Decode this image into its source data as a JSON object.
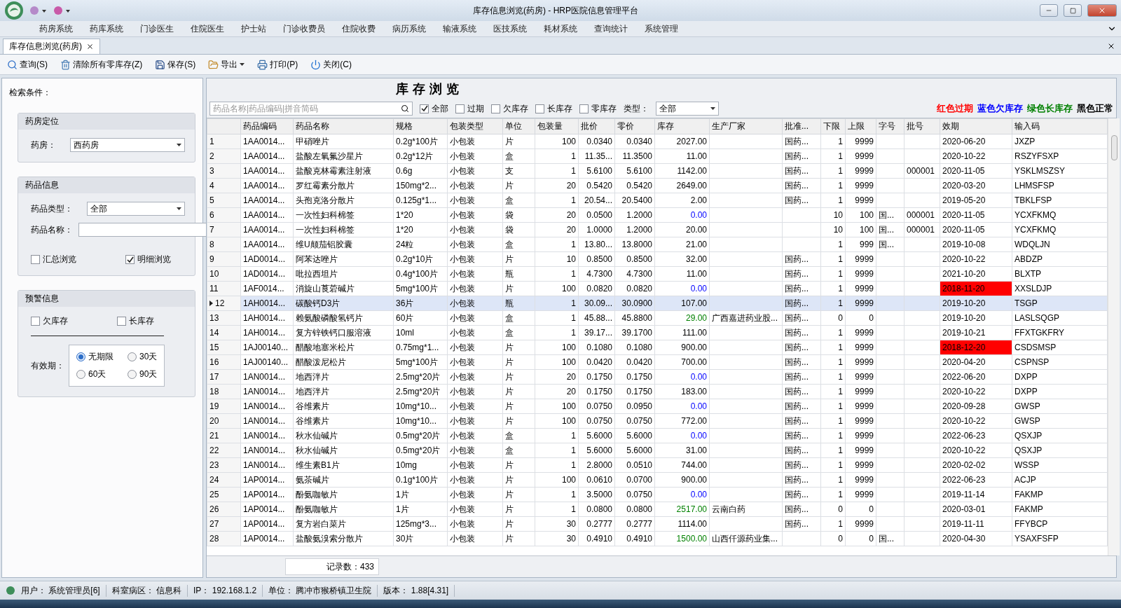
{
  "window": {
    "title": "库存信息浏览(药房) - HRP医院信息管理平台"
  },
  "menu": [
    "药房系统",
    "药库系统",
    "门诊医生",
    "住院医生",
    "护士站",
    "门诊收费员",
    "住院收费",
    "病历系统",
    "输液系统",
    "医技系统",
    "耗材系统",
    "查询统计",
    "系统管理"
  ],
  "doc_tabs": [
    {
      "label": "库存信息浏览(药房)",
      "selected": true
    }
  ],
  "toolbar": [
    {
      "kind": "search",
      "label": "查询(S)",
      "dropdown": false
    },
    {
      "kind": "clear",
      "label": "清除所有零库存(Z)",
      "dropdown": false
    },
    {
      "kind": "save",
      "label": "保存(S)",
      "dropdown": false
    },
    {
      "kind": "export",
      "label": "导出",
      "dropdown": true
    },
    {
      "kind": "print",
      "label": "打印(P)",
      "dropdown": false
    },
    {
      "kind": "close",
      "label": "关闭(C)",
      "dropdown": false
    }
  ],
  "criteria": {
    "label": "检索条件：",
    "pharmacy_group": {
      "title": "药房定位",
      "field_label": "药房：",
      "value": "西药房"
    },
    "drug_group": {
      "title": "药品信息",
      "type_label": "药品类型：",
      "type_value": "全部",
      "name_label": "药品名称：",
      "checkboxes": [
        {
          "label": "汇总浏览",
          "checked": false
        },
        {
          "label": "明细浏览",
          "checked": true
        }
      ]
    },
    "warning_group": {
      "title": "预警信息",
      "checkboxes": [
        {
          "label": "欠库存",
          "checked": false
        },
        {
          "label": "长库存",
          "checked": false
        }
      ],
      "expiry_label": "有效期：",
      "expiry_options": [
        {
          "label": "无期限",
          "selected": true
        },
        {
          "label": "30天",
          "selected": false
        },
        {
          "label": "60天",
          "selected": false
        },
        {
          "label": "90天",
          "selected": false
        }
      ]
    }
  },
  "browser": {
    "title": "库存浏览",
    "search": {
      "placeholder": "药品名称|药品编码|拼音简码"
    },
    "filters": [
      {
        "label": "全部",
        "checked": true
      },
      {
        "label": "过期",
        "checked": false
      },
      {
        "label": "欠库存",
        "checked": false
      },
      {
        "label": "长库存",
        "checked": false
      },
      {
        "label": "零库存",
        "checked": false
      }
    ],
    "type_label": "类型：",
    "type_value": "全部",
    "legend": [
      {
        "label": "红色过期",
        "color": "#ff0000"
      },
      {
        "label": "蓝色欠库存",
        "color": "#0000ff"
      },
      {
        "label": "绿色长库存",
        "color": "#008000"
      },
      {
        "label": "黑色正常",
        "color": "#000000"
      }
    ],
    "table": {
      "columns": [
        "药品编码",
        "药品名称",
        "规格",
        "包装类型",
        "单位",
        "包装量",
        "批价",
        "零价",
        "库存",
        "生产厂家",
        "批准...",
        "下限",
        "上限",
        "字号",
        "批号",
        "效期",
        "输入码"
      ],
      "rows": [
        {
          "selected": false,
          "low_stock": false,
          "long_stock": false,
          "expired": false,
          "n": "1",
          "code": "1AA0014...",
          "name": "甲硝唑片",
          "spec": "0.2g*100片",
          "pack": "小包装",
          "unit": "片",
          "qty": "100",
          "wp": "0.0340",
          "rp": "0.0340",
          "stock": "2027.00",
          "appr": "国药...",
          "lo": "1",
          "hi": "9999",
          "exp": "2020-06-20",
          "input": "JXZP"
        },
        {
          "selected": false,
          "low_stock": false,
          "long_stock": false,
          "expired": false,
          "n": "2",
          "code": "1AA0014...",
          "name": "盐酸左氧氟沙星片",
          "spec": "0.2g*12片",
          "pack": "小包装",
          "unit": "盒",
          "qty": "1",
          "wp": "11.35...",
          "rp": "11.3500",
          "stock": "11.00",
          "appr": "国药...",
          "lo": "1",
          "hi": "9999",
          "exp": "2020-10-22",
          "input": "RSZYFSXP"
        },
        {
          "selected": false,
          "low_stock": false,
          "long_stock": false,
          "expired": false,
          "n": "3",
          "code": "1AA0014...",
          "name": "盐酸克林霉素注射液",
          "spec": "0.6g",
          "pack": "小包装",
          "unit": "支",
          "qty": "1",
          "wp": "5.6100",
          "rp": "5.6100",
          "stock": "1142.00",
          "appr": "国药...",
          "lo": "1",
          "hi": "9999",
          "batch": "000001",
          "exp": "2020-11-05",
          "input": "YSKLMSZSY"
        },
        {
          "selected": false,
          "low_stock": false,
          "long_stock": false,
          "expired": false,
          "n": "4",
          "code": "1AA0014...",
          "name": "罗红霉素分散片",
          "spec": "150mg*2...",
          "pack": "小包装",
          "unit": "片",
          "qty": "20",
          "wp": "0.5420",
          "rp": "0.5420",
          "stock": "2649.00",
          "appr": "国药...",
          "lo": "1",
          "hi": "9999",
          "exp": "2020-03-20",
          "input": "LHMSFSP"
        },
        {
          "selected": false,
          "low_stock": false,
          "long_stock": false,
          "expired": false,
          "n": "5",
          "code": "1AA0014...",
          "name": "头孢克洛分散片",
          "spec": "0.125g*1...",
          "pack": "小包装",
          "unit": "盒",
          "qty": "1",
          "wp": "20.54...",
          "rp": "20.5400",
          "stock": "2.00",
          "appr": "国药...",
          "lo": "1",
          "hi": "9999",
          "exp": "2019-05-20",
          "input": "TBKLFSP"
        },
        {
          "selected": false,
          "low_stock": true,
          "long_stock": false,
          "expired": false,
          "n": "6",
          "code": "1AA0014...",
          "name": "一次性妇科棉签",
          "spec": "1*20",
          "pack": "小包装",
          "unit": "袋",
          "qty": "20",
          "wp": "0.0500",
          "rp": "1.2000",
          "stock": "0.00",
          "lo": "10",
          "hi": "100",
          "zh": "国...",
          "batch": "000001",
          "exp": "2020-11-05",
          "input": "YCXFKMQ"
        },
        {
          "selected": false,
          "low_stock": false,
          "long_stock": false,
          "expired": false,
          "n": "7",
          "code": "1AA0014...",
          "name": "一次性妇科棉签",
          "spec": "1*20",
          "pack": "小包装",
          "unit": "袋",
          "qty": "20",
          "wp": "1.0000",
          "rp": "1.2000",
          "stock": "20.00",
          "lo": "10",
          "hi": "100",
          "zh": "国...",
          "batch": "000001",
          "exp": "2020-11-05",
          "input": "YCXFKMQ"
        },
        {
          "selected": false,
          "low_stock": false,
          "long_stock": false,
          "expired": false,
          "n": "8",
          "code": "1AA0014...",
          "name": "维U颠茄铝胶囊",
          "spec": "24粒",
          "pack": "小包装",
          "unit": "盒",
          "qty": "1",
          "wp": "13.80...",
          "rp": "13.8000",
          "stock": "21.00",
          "lo": "1",
          "hi": "999",
          "zh": "国...",
          "exp": "2019-10-08",
          "input": "WDQLJN"
        },
        {
          "selected": false,
          "low_stock": false,
          "long_stock": false,
          "expired": false,
          "n": "9",
          "code": "1AD0014...",
          "name": "阿苯达唑片",
          "spec": "0.2g*10片",
          "pack": "小包装",
          "unit": "片",
          "qty": "10",
          "wp": "0.8500",
          "rp": "0.8500",
          "stock": "32.00",
          "appr": "国药...",
          "lo": "1",
          "hi": "9999",
          "exp": "2020-10-22",
          "input": "ABDZP"
        },
        {
          "selected": false,
          "low_stock": false,
          "long_stock": false,
          "expired": false,
          "n": "10",
          "code": "1AD0014...",
          "name": "吡拉西坦片",
          "spec": "0.4g*100片",
          "pack": "小包装",
          "unit": "瓶",
          "qty": "1",
          "wp": "4.7300",
          "rp": "4.7300",
          "stock": "11.00",
          "appr": "国药...",
          "lo": "1",
          "hi": "9999",
          "exp": "2021-10-20",
          "input": "BLXTP"
        },
        {
          "selected": false,
          "low_stock": true,
          "long_stock": false,
          "expired": true,
          "n": "11",
          "code": "1AF0014...",
          "name": "消旋山莨菪碱片",
          "spec": "5mg*100片",
          "pack": "小包装",
          "unit": "片",
          "qty": "100",
          "wp": "0.0820",
          "rp": "0.0820",
          "stock": "0.00",
          "appr": "国药...",
          "lo": "1",
          "hi": "9999",
          "exp": "2018-11-20",
          "input": "XXSLDJP"
        },
        {
          "selected": true,
          "low_stock": false,
          "long_stock": false,
          "expired": false,
          "n": "12",
          "code": "1AH0014...",
          "name": "碳酸钙D3片",
          "spec": "36片",
          "pack": "小包装",
          "unit": "瓶",
          "qty": "1",
          "wp": "30.09...",
          "rp": "30.0900",
          "stock": "107.00",
          "appr": "国药...",
          "lo": "1",
          "hi": "9999",
          "exp": "2019-10-20",
          "input": "TSGP"
        },
        {
          "selected": false,
          "low_stock": false,
          "long_stock": true,
          "expired": false,
          "n": "13",
          "code": "1AH0014...",
          "name": "赖氨酸磷酸氢钙片",
          "spec": "60片",
          "pack": "小包装",
          "unit": "盒",
          "qty": "1",
          "wp": "45.88...",
          "rp": "45.8800",
          "stock": "29.00",
          "maker": "广西嘉进药业股...",
          "appr": "国药...",
          "lo": "0",
          "hi": "0",
          "exp": "2019-10-20",
          "input": "LASLSQGP"
        },
        {
          "selected": false,
          "low_stock": false,
          "long_stock": false,
          "expired": false,
          "n": "14",
          "code": "1AH0014...",
          "name": "复方锌铁钙口服溶液",
          "spec": "10ml",
          "pack": "小包装",
          "unit": "盒",
          "qty": "1",
          "wp": "39.17...",
          "rp": "39.1700",
          "stock": "111.00",
          "appr": "国药...",
          "lo": "1",
          "hi": "9999",
          "exp": "2019-10-21",
          "input": "FFXTGKFRY"
        },
        {
          "selected": false,
          "low_stock": false,
          "long_stock": false,
          "expired": true,
          "n": "15",
          "code": "1AJ00140...",
          "name": "醋酸地塞米松片",
          "spec": "0.75mg*1...",
          "pack": "小包装",
          "unit": "片",
          "qty": "100",
          "wp": "0.1080",
          "rp": "0.1080",
          "stock": "900.00",
          "appr": "国药...",
          "lo": "1",
          "hi": "9999",
          "exp": "2018-12-20",
          "input": "CSDSMSP"
        },
        {
          "selected": false,
          "low_stock": false,
          "long_stock": false,
          "expired": false,
          "n": "16",
          "code": "1AJ00140...",
          "name": "醋酸泼尼松片",
          "spec": "5mg*100片",
          "pack": "小包装",
          "unit": "片",
          "qty": "100",
          "wp": "0.0420",
          "rp": "0.0420",
          "stock": "700.00",
          "appr": "国药...",
          "lo": "1",
          "hi": "9999",
          "exp": "2020-04-20",
          "input": "CSPNSP"
        },
        {
          "selected": false,
          "low_stock": true,
          "long_stock": false,
          "expired": false,
          "n": "17",
          "code": "1AN0014...",
          "name": "地西泮片",
          "spec": "2.5mg*20片",
          "pack": "小包装",
          "unit": "片",
          "qty": "20",
          "wp": "0.1750",
          "rp": "0.1750",
          "stock": "0.00",
          "appr": "国药...",
          "lo": "1",
          "hi": "9999",
          "exp": "2022-06-20",
          "input": "DXPP"
        },
        {
          "selected": false,
          "low_stock": false,
          "long_stock": false,
          "expired": false,
          "n": "18",
          "code": "1AN0014...",
          "name": "地西泮片",
          "spec": "2.5mg*20片",
          "pack": "小包装",
          "unit": "片",
          "qty": "20",
          "wp": "0.1750",
          "rp": "0.1750",
          "stock": "183.00",
          "appr": "国药...",
          "lo": "1",
          "hi": "9999",
          "exp": "2020-10-22",
          "input": "DXPP"
        },
        {
          "selected": false,
          "low_stock": true,
          "long_stock": false,
          "expired": false,
          "n": "19",
          "code": "1AN0014...",
          "name": "谷维素片",
          "spec": "10mg*10...",
          "pack": "小包装",
          "unit": "片",
          "qty": "100",
          "wp": "0.0750",
          "rp": "0.0950",
          "stock": "0.00",
          "appr": "国药...",
          "lo": "1",
          "hi": "9999",
          "exp": "2020-09-28",
          "input": "GWSP"
        },
        {
          "selected": false,
          "low_stock": false,
          "long_stock": false,
          "expired": false,
          "n": "20",
          "code": "1AN0014...",
          "name": "谷维素片",
          "spec": "10mg*10...",
          "pack": "小包装",
          "unit": "片",
          "qty": "100",
          "wp": "0.0750",
          "rp": "0.0750",
          "stock": "772.00",
          "appr": "国药...",
          "lo": "1",
          "hi": "9999",
          "exp": "2020-10-22",
          "input": "GWSP"
        },
        {
          "selected": false,
          "low_stock": true,
          "long_stock": false,
          "expired": false,
          "n": "21",
          "code": "1AN0014...",
          "name": "秋水仙碱片",
          "spec": "0.5mg*20片",
          "pack": "小包装",
          "unit": "盒",
          "qty": "1",
          "wp": "5.6000",
          "rp": "5.6000",
          "stock": "0.00",
          "appr": "国药...",
          "lo": "1",
          "hi": "9999",
          "exp": "2022-06-23",
          "input": "QSXJP"
        },
        {
          "selected": false,
          "low_stock": false,
          "long_stock": false,
          "expired": false,
          "n": "22",
          "code": "1AN0014...",
          "name": "秋水仙碱片",
          "spec": "0.5mg*20片",
          "pack": "小包装",
          "unit": "盒",
          "qty": "1",
          "wp": "5.6000",
          "rp": "5.6000",
          "stock": "31.00",
          "appr": "国药...",
          "lo": "1",
          "hi": "9999",
          "exp": "2020-10-22",
          "input": "QSXJP"
        },
        {
          "selected": false,
          "low_stock": false,
          "long_stock": false,
          "expired": false,
          "n": "23",
          "code": "1AN0014...",
          "name": "维生素B1片",
          "spec": "10mg",
          "pack": "小包装",
          "unit": "片",
          "qty": "1",
          "wp": "2.8000",
          "rp": "0.0510",
          "stock": "744.00",
          "appr": "国药...",
          "lo": "1",
          "hi": "9999",
          "exp": "2020-02-02",
          "input": "WSSP"
        },
        {
          "selected": false,
          "low_stock": false,
          "long_stock": false,
          "expired": false,
          "n": "24",
          "code": "1AP0014...",
          "name": "氨茶碱片",
          "spec": "0.1g*100片",
          "pack": "小包装",
          "unit": "片",
          "qty": "100",
          "wp": "0.0610",
          "rp": "0.0700",
          "stock": "900.00",
          "appr": "国药...",
          "lo": "1",
          "hi": "9999",
          "exp": "2022-06-23",
          "input": "ACJP"
        },
        {
          "selected": false,
          "low_stock": true,
          "long_stock": false,
          "expired": false,
          "n": "25",
          "code": "1AP0014...",
          "name": "酚氨咖敏片",
          "spec": "1片",
          "pack": "小包装",
          "unit": "片",
          "qty": "1",
          "wp": "3.5000",
          "rp": "0.0750",
          "stock": "0.00",
          "appr": "国药...",
          "lo": "1",
          "hi": "9999",
          "exp": "2019-11-14",
          "input": "FAKMP"
        },
        {
          "selected": false,
          "low_stock": false,
          "long_stock": true,
          "expired": false,
          "n": "26",
          "code": "1AP0014...",
          "name": "酚氨咖敏片",
          "spec": "1片",
          "pack": "小包装",
          "unit": "片",
          "qty": "1",
          "wp": "0.0800",
          "rp": "0.0800",
          "stock": "2517.00",
          "maker": "云南白药",
          "appr": "国药...",
          "lo": "0",
          "hi": "0",
          "exp": "2020-03-01",
          "input": "FAKMP"
        },
        {
          "selected": false,
          "low_stock": false,
          "long_stock": false,
          "expired": false,
          "n": "27",
          "code": "1AP0014...",
          "name": "复方岩白菜片",
          "spec": "125mg*3...",
          "pack": "小包装",
          "unit": "片",
          "qty": "30",
          "wp": "0.2777",
          "rp": "0.2777",
          "stock": "1114.00",
          "appr": "国药...",
          "lo": "1",
          "hi": "9999",
          "exp": "2019-11-11",
          "input": "FFYBCP"
        },
        {
          "selected": false,
          "low_stock": false,
          "long_stock": true,
          "expired": false,
          "n": "28",
          "code": "1AP0014...",
          "name": "盐酸氨溴索分散片",
          "spec": "30片",
          "pack": "小包装",
          "unit": "片",
          "qty": "30",
          "wp": "0.4910",
          "rp": "0.4910",
          "stock": "1500.00",
          "maker": "山西仟源药业集...",
          "lo": "0",
          "hi": "0",
          "zh": "国...",
          "exp": "2020-04-30",
          "input": "YSAXFSFP"
        }
      ]
    },
    "record_count": "记录数：433"
  },
  "status_bar": [
    {
      "label": "用户：",
      "value": "系统管理员[6]"
    },
    {
      "label": "科室病区：",
      "value": "信息科"
    },
    {
      "label": "IP：",
      "value": "192.168.1.2"
    },
    {
      "label": "单位：",
      "value": "腾冲市猴桥镇卫生院"
    },
    {
      "label": "版本：",
      "value": "1.88[4.31]"
    }
  ]
}
